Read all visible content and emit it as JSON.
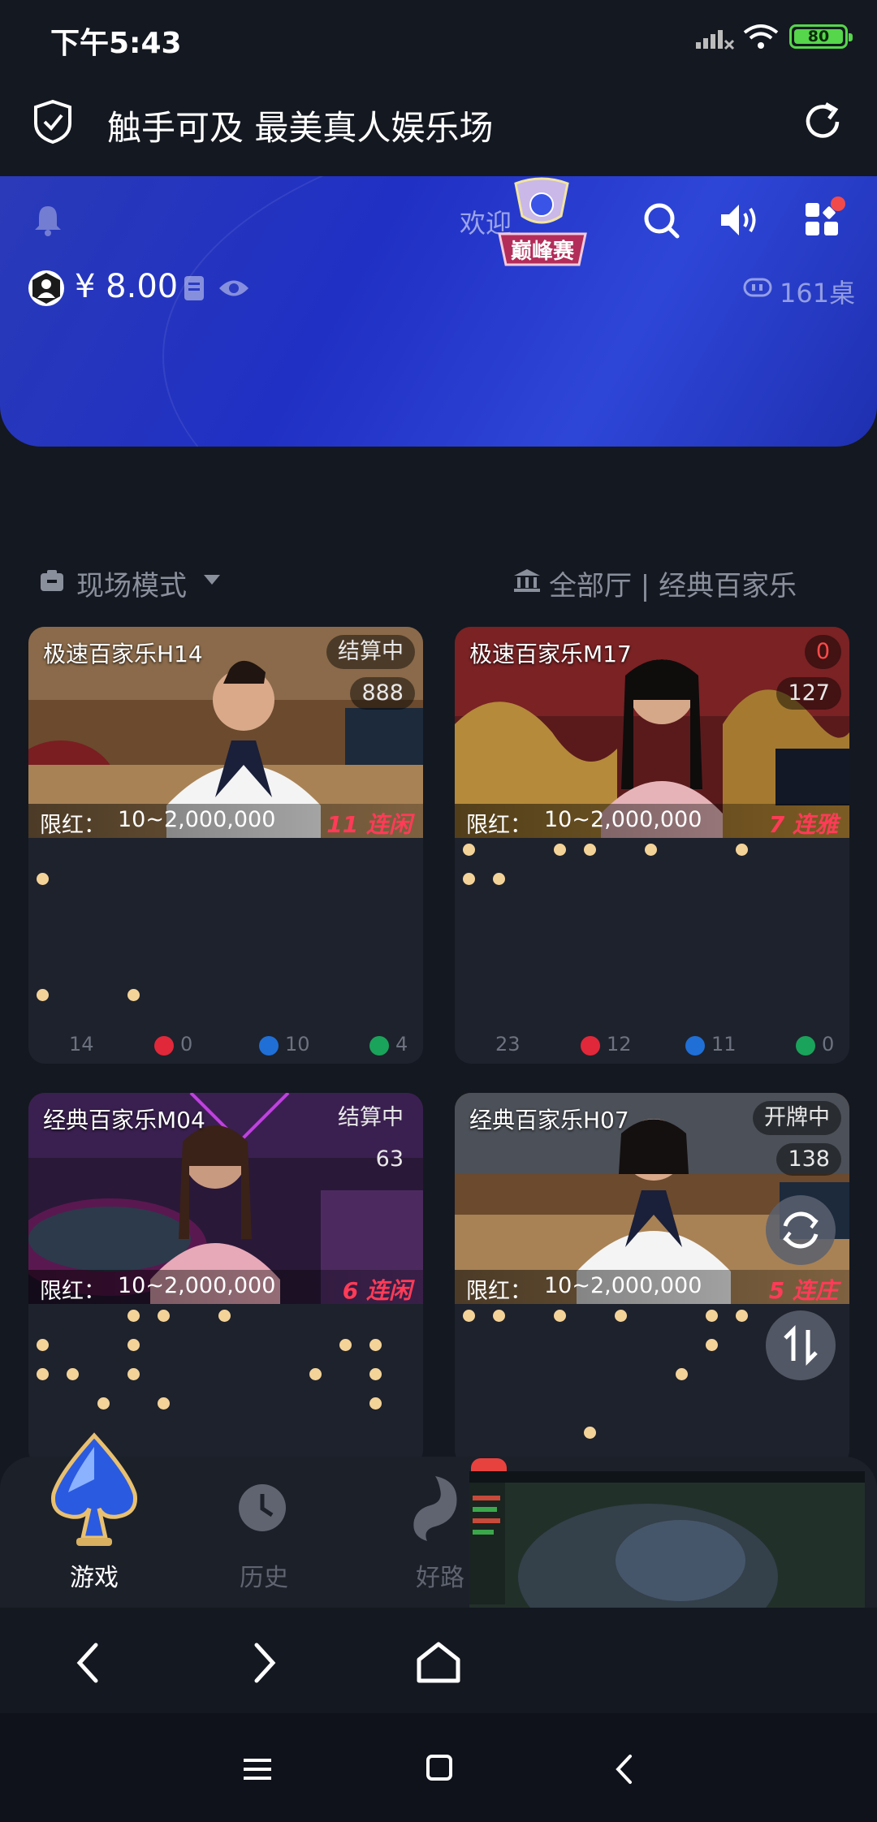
{
  "status_bar": {
    "time": "下午5:43",
    "battery": "80"
  },
  "header": {
    "title": "触手可及 最美真人娱乐场"
  },
  "banner": {
    "welcome": "欢迎",
    "trophy_text": "巅峰赛",
    "balance": "¥ 8.00",
    "table_count": "161桌"
  },
  "mode_bar": {
    "mode_label": "现场模式",
    "hall_label": "全部厅 | 经典百家乐"
  },
  "tables": [
    {
      "name": "极速百家乐H14",
      "status": "结算中",
      "timer": "888",
      "limit_label": "限红：",
      "limit": "10~2,000,000",
      "streak": "11 连闲",
      "stats": {
        "total": "14",
        "red": "0",
        "blue": "10",
        "green": "4"
      }
    },
    {
      "name": "极速百家乐M17",
      "status": "0",
      "timer": "127",
      "limit_label": "限红：",
      "limit": "10~2,000,000",
      "streak": "7 连雅",
      "stats": {
        "total": "23",
        "red": "12",
        "blue": "11",
        "green": "0"
      }
    },
    {
      "name": "经典百家乐M04",
      "status": "结算中",
      "timer": "63",
      "limit_label": "限红：",
      "limit": "10~2,000,000",
      "streak": "6 连闲"
    },
    {
      "name": "经典百家乐H07",
      "status": "开牌中",
      "timer": "138",
      "limit_label": "限红：",
      "limit": "10~2,000,000",
      "streak": "5 连庄"
    }
  ],
  "bottom_nav": {
    "game": "游戏",
    "history": "历史",
    "road": "好路"
  },
  "colors": {
    "accent_blue": "#2436c8",
    "dot": "#f4d399",
    "red": "#e0283a",
    "blue": "#1f6fd6",
    "green": "#1aa35a",
    "streak": "#ff3b57"
  }
}
